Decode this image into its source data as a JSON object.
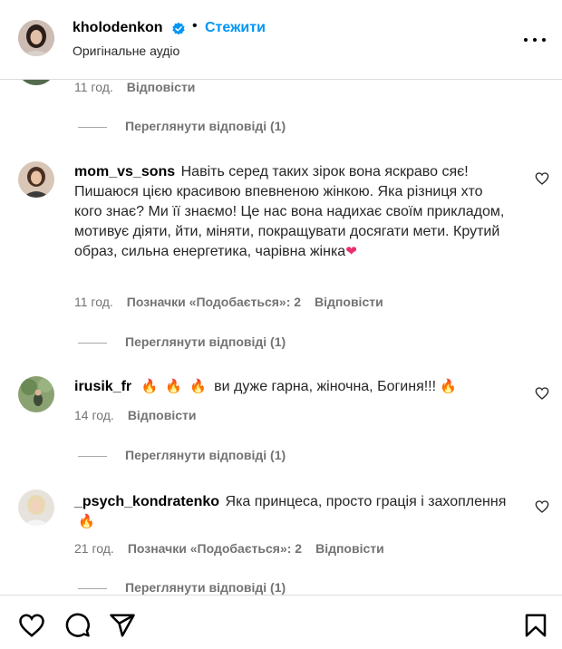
{
  "header": {
    "username": "kholodenkon",
    "follow_label": "Стежити",
    "separator": "•",
    "audio_label": "Оригінальне аудіо"
  },
  "top_partial": {
    "time": "11 год.",
    "reply_label": "Відповісти",
    "view_replies": "Переглянути відповіді (1)"
  },
  "comments": [
    {
      "username": "mom_vs_sons",
      "text": "Навіть серед таких зірок вона яскраво сяє! Пишаюся цією красивою впевненою жінкою. Яка різниця хто кого знає? Ми її знаємо! Це нас вона надихає своїм прикладом, мотивує діяти, йти, міняти, покращувати досягати мети. Крутий образ, сильна енергетика, чарівна жінка",
      "time": "11 год.",
      "likes": "Позначки «Подобається»: 2",
      "reply_label": "Відповісти",
      "view_replies": "Переглянути відповіді (1)"
    },
    {
      "username": "irusik_fr",
      "text": "ви дуже гарна, жіночна, Богиня!!!",
      "time": "14 год.",
      "reply_label": "Відповісти",
      "view_replies": "Переглянути відповіді (1)"
    },
    {
      "username": "_psych_kondratenko",
      "text": "Яка принцеса, просто грація і захоплення",
      "time": "21 год.",
      "likes": "Позначки «Подобається»: 2",
      "reply_label": "Відповісти",
      "view_replies": "Переглянути відповіді (1)"
    }
  ],
  "icons": [
    "heart-icon",
    "comment-icon",
    "share-icon",
    "bookmark-icon",
    "verified-badge-icon",
    "more-options-icon",
    "fire-emoji",
    "pink-heart-emoji"
  ],
  "colors": {
    "accent": "#0095f6",
    "muted": "#737373",
    "verified": "#0095f6"
  }
}
